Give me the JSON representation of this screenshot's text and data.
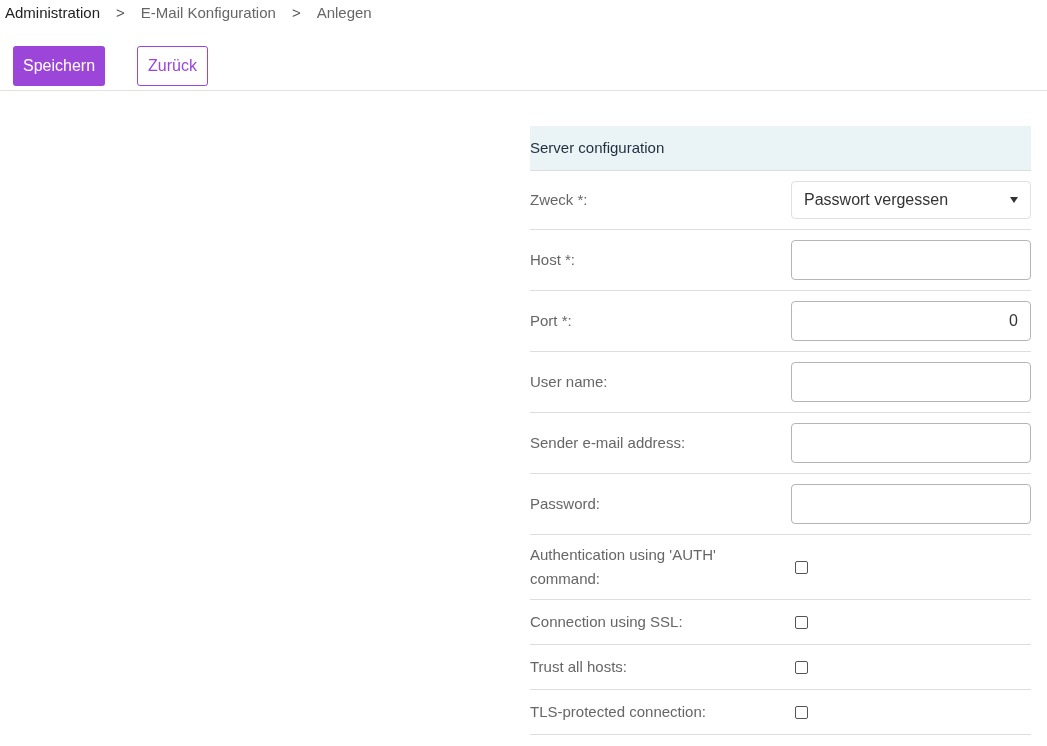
{
  "breadcrumb": [
    {
      "label": "Administration"
    },
    {
      "label": "E-Mail Konfiguration"
    },
    {
      "label": "Anlegen"
    }
  ],
  "breadcrumb_separator": ">",
  "buttons": [
    {
      "label": "Speichern",
      "kind": "primary"
    },
    {
      "label": "Zurück",
      "kind": "outline"
    }
  ],
  "section": {
    "title": "Server configuration",
    "fields": [
      {
        "kind": "select",
        "label": "Zweck *:",
        "value": "Passwort vergessen"
      },
      {
        "kind": "text",
        "label": "Host *:"
      },
      {
        "kind": "number",
        "label": "Port *:",
        "value": "0"
      },
      {
        "kind": "text",
        "label": "User name:"
      },
      {
        "kind": "text",
        "label": "Sender e-mail address:"
      },
      {
        "kind": "password",
        "label": "Password:"
      },
      {
        "kind": "checkbox",
        "label": "Authentication using 'AUTH' command:",
        "checked": false
      },
      {
        "kind": "checkbox",
        "label": "Connection using SSL:",
        "checked": false
      },
      {
        "kind": "checkbox",
        "label": "Trust all hosts:",
        "checked": false
      },
      {
        "kind": "checkbox",
        "label": "TLS-protected connection:",
        "checked": false
      }
    ]
  }
}
